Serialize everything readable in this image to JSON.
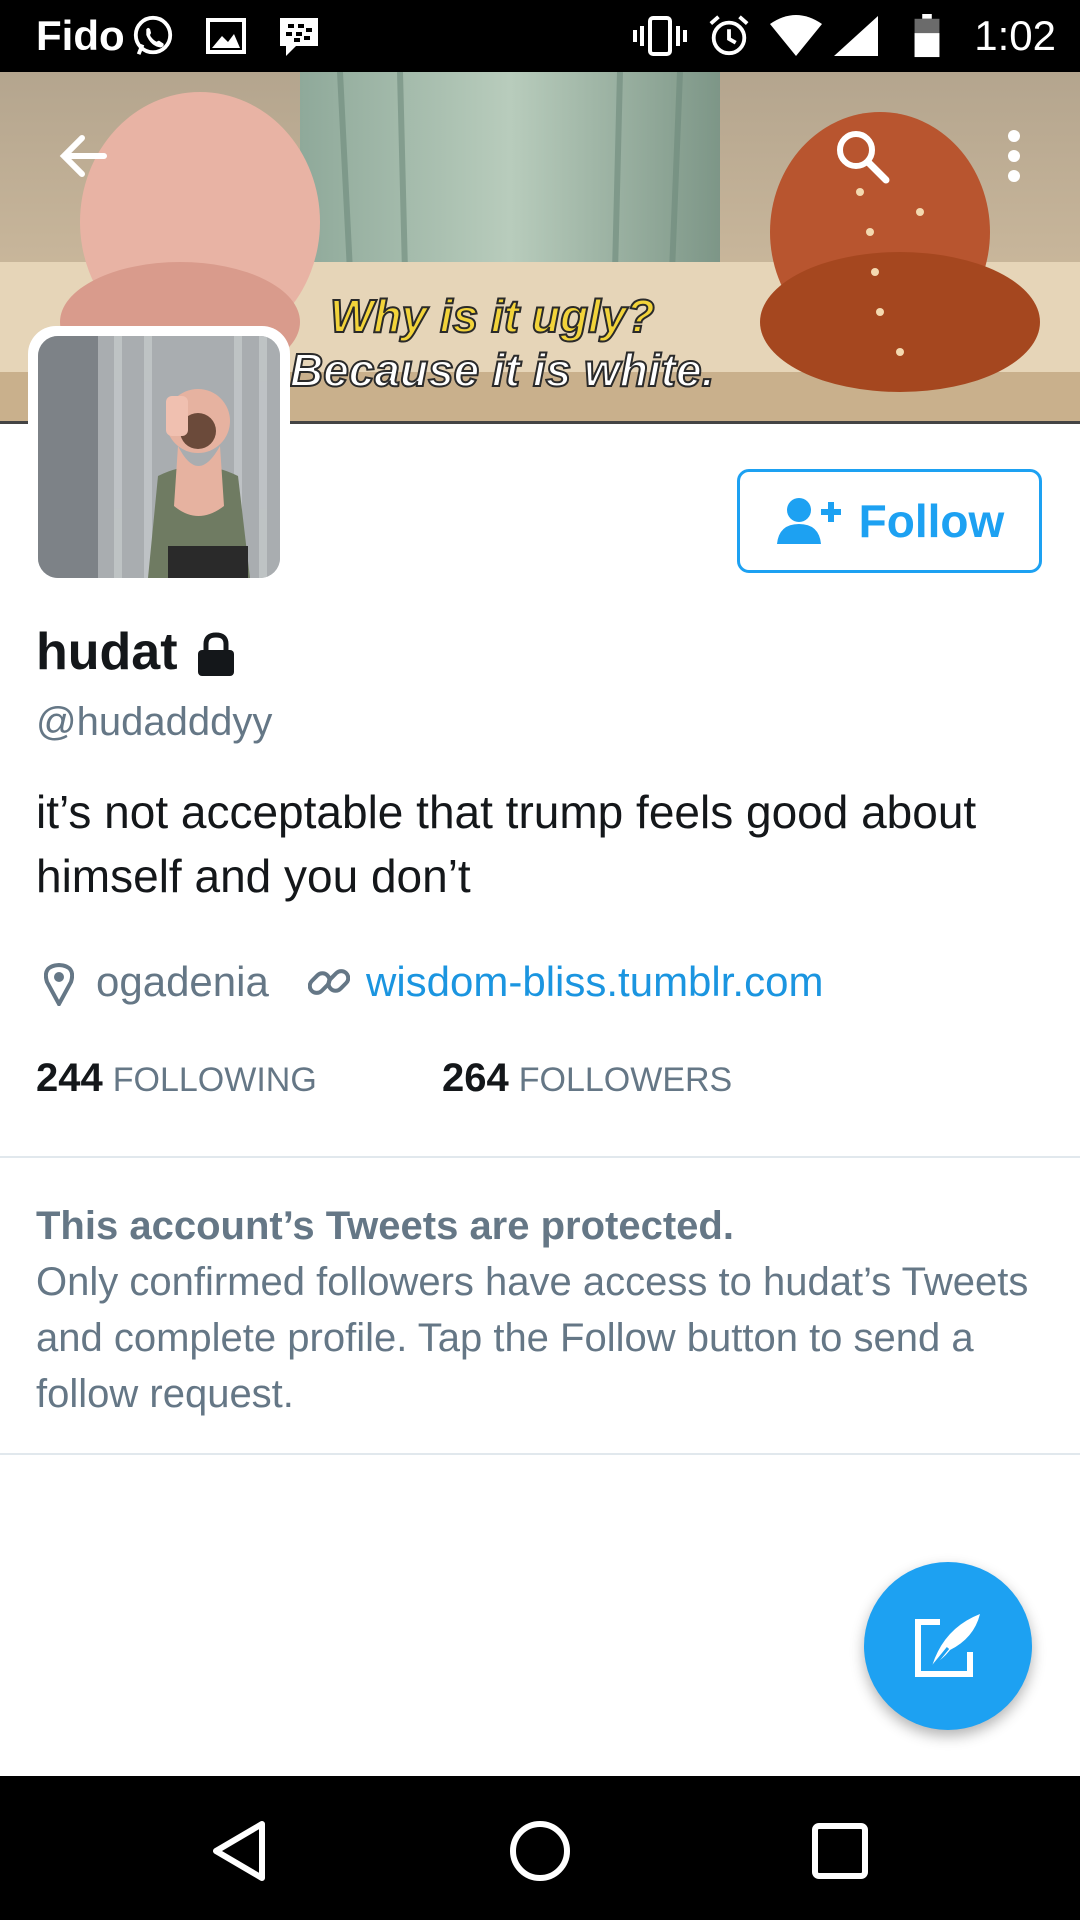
{
  "status_bar": {
    "carrier": "Fido",
    "time": "1:02",
    "icons": [
      "whatsapp-icon",
      "gallery-icon",
      "bbm-icon",
      "vibrate-icon",
      "alarm-icon",
      "wifi-icon",
      "signal-icon",
      "battery-icon"
    ]
  },
  "banner": {
    "caption_line1": "Why is it ugly?",
    "caption_line2": "Because it is white.",
    "icons": [
      "back-arrow-icon",
      "search-icon",
      "more-vert-icon"
    ]
  },
  "follow_button": {
    "label": "Follow",
    "icon": "add-user-icon"
  },
  "profile": {
    "display_name": "hudat",
    "handle": "@hudadddyy",
    "bio": "it’s not acceptable that trump feels good about himself and you don’t",
    "location": "ogadenia",
    "website": "wisdom-bliss.tumblr.com"
  },
  "stats": {
    "following_count": "244",
    "following_label": "FOLLOWING",
    "followers_count": "264",
    "followers_label": "FOLLOWERS"
  },
  "protected_notice": {
    "title": "This account’s Tweets are protected.",
    "body": "Only confirmed followers have access to hudat’s Tweets and complete profile. Tap the Follow button to send a follow request."
  },
  "fab": {
    "icon": "compose-tweet-icon"
  },
  "nav_bar": {
    "icons": [
      "nav-back-icon",
      "nav-home-icon",
      "nav-recents-icon"
    ]
  },
  "colors": {
    "accent": "#1da1f2",
    "link": "#1b95e0",
    "secondary_text": "#657786"
  }
}
